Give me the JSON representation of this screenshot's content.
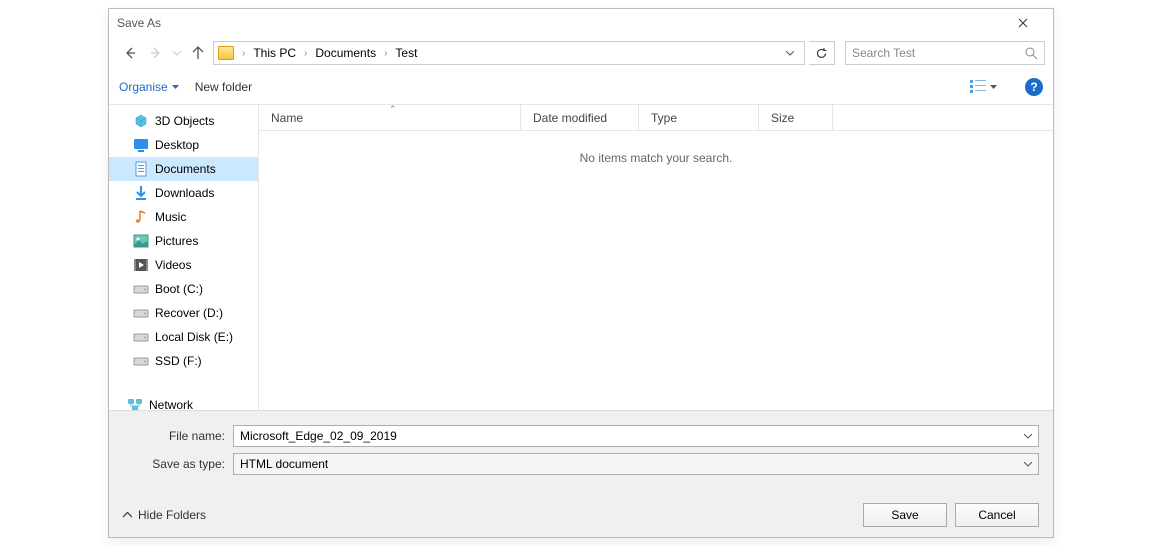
{
  "title": "Save As",
  "breadcrumb": [
    "This PC",
    "Documents",
    "Test"
  ],
  "search_placeholder": "Search Test",
  "toolbar": {
    "organise": "Organise",
    "new_folder": "New folder"
  },
  "columns": {
    "name": "Name",
    "date": "Date modified",
    "type": "Type",
    "size": "Size"
  },
  "empty_message": "No items match your search.",
  "tree": [
    {
      "label": "3D Objects",
      "icon": "cube"
    },
    {
      "label": "Desktop",
      "icon": "desktop"
    },
    {
      "label": "Documents",
      "icon": "doc",
      "selected": true
    },
    {
      "label": "Downloads",
      "icon": "download"
    },
    {
      "label": "Music",
      "icon": "music"
    },
    {
      "label": "Pictures",
      "icon": "pictures"
    },
    {
      "label": "Videos",
      "icon": "videos"
    },
    {
      "label": "Boot (C:)",
      "icon": "drive"
    },
    {
      "label": "Recover (D:)",
      "icon": "drive"
    },
    {
      "label": "Local Disk (E:)",
      "icon": "drive"
    },
    {
      "label": "SSD (F:)",
      "icon": "drive"
    }
  ],
  "network_label": "Network",
  "filename_label": "File name:",
  "filename_value": "Microsoft_Edge_02_09_2019",
  "savetype_label": "Save as type:",
  "savetype_value": "HTML document",
  "hide_folders": "Hide Folders",
  "save_label": "Save",
  "cancel_label": "Cancel"
}
